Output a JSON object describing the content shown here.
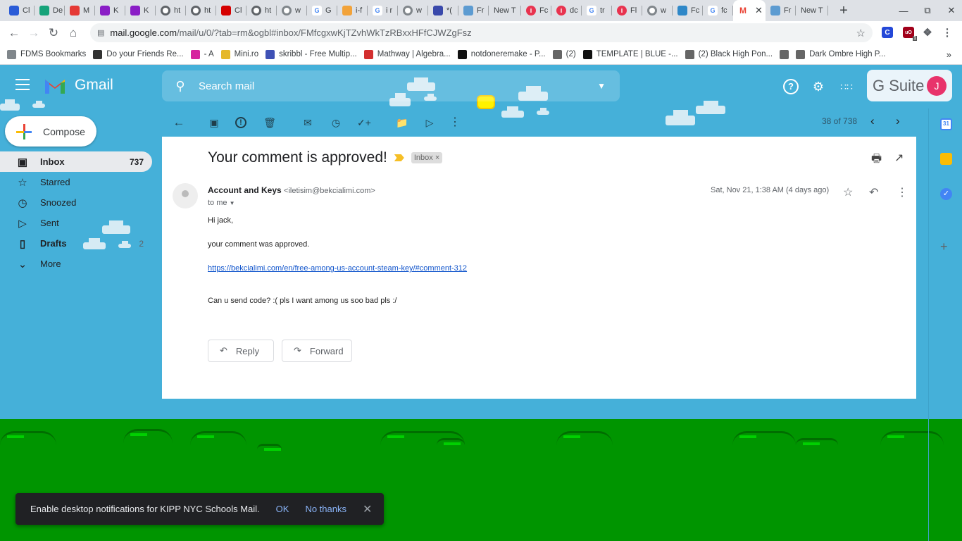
{
  "browser": {
    "tabs": [
      {
        "title": "Cl",
        "icon": "c-icon",
        "color": "#2a5bd7"
      },
      {
        "title": "De",
        "icon": "shield-icon",
        "color": "#16a37a"
      },
      {
        "title": "M",
        "icon": "ring-icon",
        "color": "#e53935"
      },
      {
        "title": "K",
        "icon": "kv-icon",
        "color": "#8a1ec6"
      },
      {
        "title": "K",
        "icon": "kv-icon",
        "color": "#8a1ec6"
      },
      {
        "title": "ht",
        "icon": "globe-icon",
        "color": "#5f6368"
      },
      {
        "title": "ht",
        "icon": "globe-icon",
        "color": "#5f6368"
      },
      {
        "title": "Cl",
        "icon": "dx-icon",
        "color": "#d50000"
      },
      {
        "title": "ht",
        "icon": "globe-icon",
        "color": "#5f6368"
      },
      {
        "title": "w",
        "icon": "globe-icon",
        "color": "#80868b"
      },
      {
        "title": "G",
        "icon": "google-icon",
        "color": "#4285f4"
      },
      {
        "title": "i-f",
        "icon": "cube-icon",
        "color": "#f2a33a"
      },
      {
        "title": "i r",
        "icon": "google-icon",
        "color": "#4285f4"
      },
      {
        "title": "w",
        "icon": "globe-icon",
        "color": "#80868b"
      },
      {
        "title": "*(",
        "icon": "form-icon",
        "color": "#3949ab"
      },
      {
        "title": "Fr",
        "icon": "window-icon",
        "color": "#5c9bd1"
      },
      {
        "title": "New T",
        "icon": "",
        "color": ""
      },
      {
        "title": "Fc",
        "icon": "info-icon",
        "color": "#e8334f"
      },
      {
        "title": "dc",
        "icon": "info-icon",
        "color": "#e8334f"
      },
      {
        "title": "tr",
        "icon": "google-icon",
        "color": "#4285f4"
      },
      {
        "title": "Fl",
        "icon": "info-icon",
        "color": "#e8334f"
      },
      {
        "title": "w",
        "icon": "globe-icon",
        "color": "#80868b"
      },
      {
        "title": "Fc",
        "icon": "k-icon",
        "color": "#2f88c8"
      },
      {
        "title": "fc",
        "icon": "google-icon",
        "color": "#4285f4"
      },
      {
        "title": "",
        "icon": "gmail-icon",
        "color": "#ea4335",
        "active": true
      },
      {
        "title": "Fr",
        "icon": "window-icon",
        "color": "#5c9bd1"
      },
      {
        "title": "New T",
        "icon": "",
        "color": ""
      }
    ],
    "url_host": "mail.google.com",
    "url_path": "/mail/u/0/?tab=rm&ogbl#inbox/FMfcgxwKjTZvhWkTzRBxxHFfCJWZgFsz",
    "extension_badge": "1",
    "bookmarks": [
      {
        "label": "FDMS Bookmarks",
        "color": "#80868b"
      },
      {
        "label": "Do your Friends Re...",
        "color": "#333"
      },
      {
        "label": "- A",
        "color": "#d6249f"
      },
      {
        "label": "Mini.ro",
        "color": "#e5b82a"
      },
      {
        "label": "skribbl - Free Multip...",
        "color": "#3f51b5"
      },
      {
        "label": "Mathway | Algebra...",
        "color": "#d32f2f"
      },
      {
        "label": "notdoneremake - P...",
        "color": "#111"
      },
      {
        "label": "(2)",
        "color": "#666"
      },
      {
        "label": "TEMPLATE | BLUE -...",
        "color": "#111"
      },
      {
        "label": "(2) Black High Pon...",
        "color": "#666"
      },
      {
        "label": "",
        "color": "#666"
      },
      {
        "label": "Dark Ombre High P...",
        "color": "#666"
      }
    ],
    "bookmarks_more": "»"
  },
  "gmail": {
    "app_name": "Gmail",
    "search_placeholder": "Search mail",
    "gsuite_label": "G Suite",
    "avatar_initial": "J",
    "compose_label": "Compose",
    "nav": [
      {
        "label": "Inbox",
        "icon": "inbox-icon",
        "count": "737",
        "active": true
      },
      {
        "label": "Starred",
        "icon": "star-icon",
        "count": ""
      },
      {
        "label": "Snoozed",
        "icon": "clock-icon",
        "count": ""
      },
      {
        "label": "Sent",
        "icon": "send-icon",
        "count": ""
      },
      {
        "label": "Drafts",
        "icon": "draft-icon",
        "count": "2"
      },
      {
        "label": "More",
        "icon": "chevron-down-icon",
        "count": ""
      }
    ],
    "pager": "38 of 738",
    "message": {
      "subject": "Your comment is approved!",
      "label": "Inbox",
      "sender_name": "Account and Keys",
      "sender_email": "<iletisim@bekcialimi.com>",
      "to": "to me",
      "date": "Sat, Nov 21, 1:38 AM (4 days ago)",
      "body": [
        "Hi jack,",
        "your comment was approved.",
        "https://bekcialimi.com/en/free-among-us-account-steam-key/#comment-312",
        "Can u send code? :( pls I want among us soo bad pls :/"
      ],
      "reply_label": "Reply",
      "forward_label": "Forward"
    },
    "toast": {
      "text": "Enable desktop notifications for KIPP NYC Schools Mail.",
      "ok": "OK",
      "no_thanks": "No thanks"
    },
    "colors": {
      "sky": "#45b0d9",
      "grass": "#009500",
      "link": "#1155cc",
      "avatar": "#e8336b"
    }
  }
}
